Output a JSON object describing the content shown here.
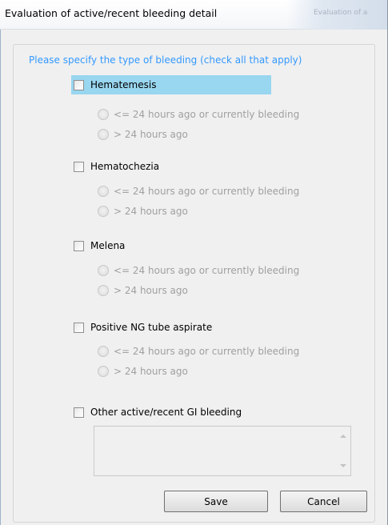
{
  "window": {
    "title": "Evaluation of active/recent bleeding detail",
    "background_title": "Evaluation of a"
  },
  "form": {
    "instruction": "Please specify the type of bleeding (check all that apply)",
    "groups": [
      {
        "label": "Hematemesis",
        "checked": false,
        "options": [
          "<= 24 hours ago or currently bleeding",
          "> 24 hours ago"
        ]
      },
      {
        "label": "Hematochezia",
        "checked": false,
        "options": [
          "<= 24 hours ago or currently bleeding",
          "> 24 hours ago"
        ]
      },
      {
        "label": "Melena",
        "checked": false,
        "options": [
          "<= 24 hours ago or currently bleeding",
          "> 24 hours ago"
        ]
      },
      {
        "label": "Positive NG tube aspirate",
        "checked": false,
        "options": [
          "<= 24 hours ago or currently bleeding",
          "> 24 hours ago"
        ]
      }
    ],
    "other": {
      "label": "Other active/recent GI bleeding",
      "checked": false,
      "text": ""
    }
  },
  "buttons": {
    "save": "Save",
    "cancel": "Cancel"
  },
  "colors": {
    "instruction": "#3399ff",
    "selection": "#99d6f0",
    "disabled_text": "#a0a0a0"
  }
}
